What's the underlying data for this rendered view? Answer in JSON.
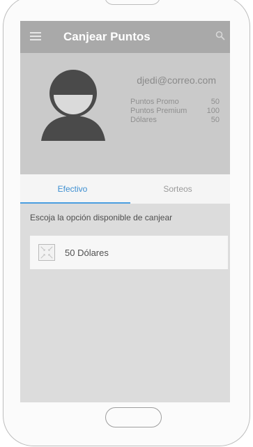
{
  "appbar": {
    "title": "Canjear Puntos",
    "menu_icon": "hamburger-menu-icon",
    "search_icon": "search-icon"
  },
  "profile": {
    "avatar_icon": "user-avatar-icon",
    "email": "djedi@correo.com",
    "stats": [
      {
        "label": "Puntos Promo",
        "value": "50"
      },
      {
        "label": "Puntos Premium",
        "value": "100"
      },
      {
        "label": "Dólares",
        "value": "50"
      }
    ]
  },
  "tabs": [
    {
      "label": "Efectivo",
      "active": true
    },
    {
      "label": "Sorteos",
      "active": false
    }
  ],
  "content": {
    "instruction": "Escoja la opción disponible de canjear",
    "options": [
      {
        "label": "50 Dólares",
        "icon": "image-placeholder-icon"
      }
    ]
  },
  "colors": {
    "appbar": "#a9a9a9",
    "profile_bg": "#cacaca",
    "screen_bg": "#dcdcdc",
    "accent": "#4a9ee0"
  }
}
